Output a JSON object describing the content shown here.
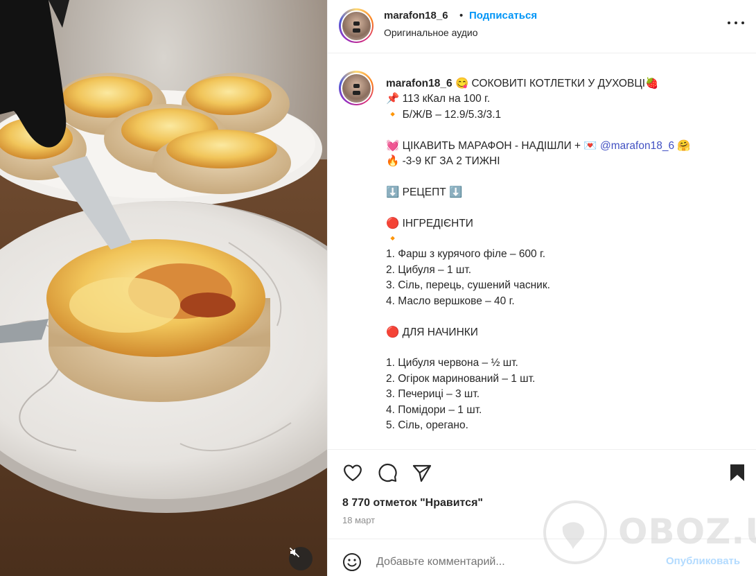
{
  "post": {
    "username": "marafon18_6",
    "separator": "•",
    "follow_label": "Подписаться",
    "audio_label": "Оригинальное аудио"
  },
  "caption": {
    "username": "marafon18_6",
    "lines": [
      "😋 СОКОВИТІ КОТЛЕТКИ У ДУХОВЦІ🍓",
      "📌 113 кКал на 100 г.",
      "🔸 Б/Ж/В – 12.9/5.3/3.1",
      "",
      "💓 ЦІКАВИТЬ МАРАФОН - НАДІШЛИ + 💌 ",
      "🔥 -3-9 КГ ЗА 2 ТИЖНІ",
      "",
      "⬇️ РЕЦЕПТ ⬇️",
      "",
      "🔴 ІНГРЕДІЄНТИ",
      "🔸",
      "1. Фарш з курячого філе – 600 г.",
      "2. Цибуля – 1 шт.",
      "3. Сіль, перець, сушений часник.",
      "4. Масло вершкове – 40 г.",
      "",
      "🔴 ДЛЯ НАЧИНКИ",
      "",
      "1. Цибуля червона – ½ шт.",
      "2. Огірок маринований – 1 шт.",
      "3. Печериці – 3 шт.",
      "4. Помідори – 1 шт.",
      "5. Сіль, орегано."
    ],
    "mention": "@marafon18_6",
    "mention_suffix": " 🤗"
  },
  "actions": {
    "likes": "8 770 отметок \"Нравится\"",
    "date": "18 март",
    "comment_placeholder": "Добавьте комментарий...",
    "post_label": "Опубликовать"
  },
  "watermark": "OBOZ.UA",
  "colors": {
    "link": "#0095f6",
    "mention": "#4150c2",
    "text": "#262626",
    "muted": "#8e8e8e",
    "post_disabled": "#b3dbff"
  },
  "icons": [
    "heart-icon",
    "comment-icon",
    "share-icon",
    "bookmark-icon",
    "emoji-icon",
    "mute-icon",
    "more-icon"
  ]
}
